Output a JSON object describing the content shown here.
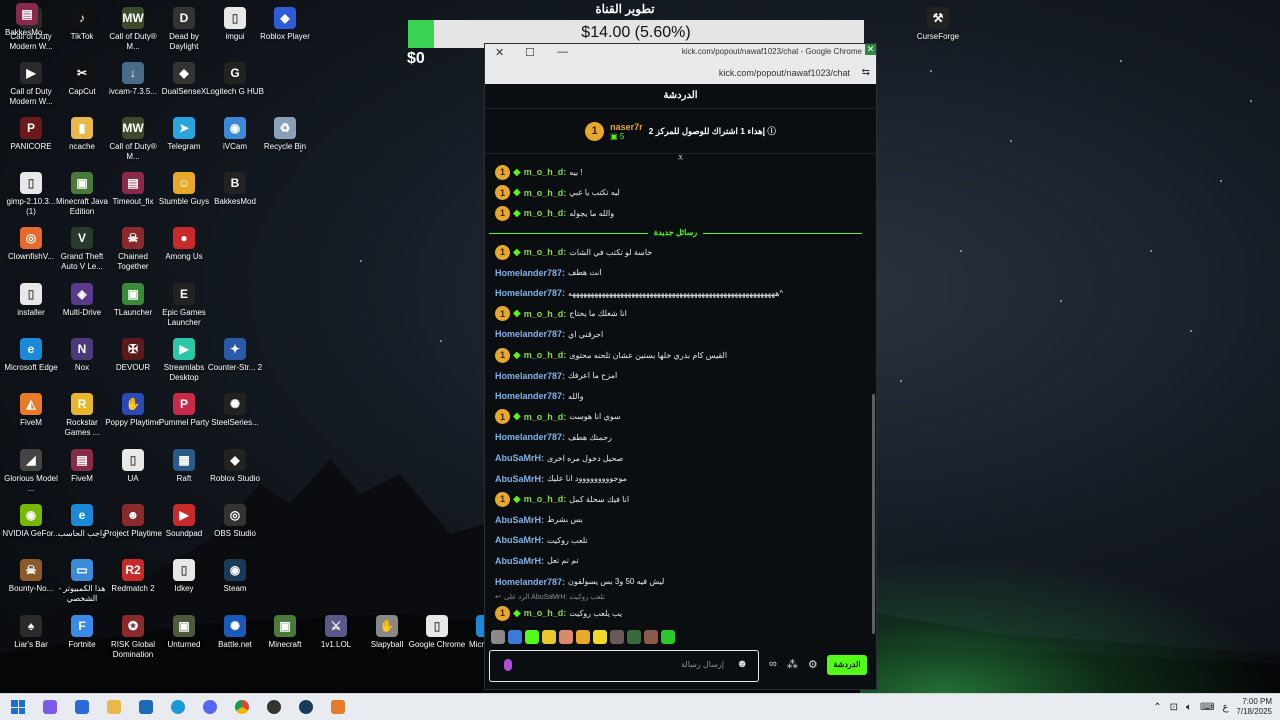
{
  "desktop_icons": [
    {
      "label": "Call of Duty Modern W...",
      "icon": "cod-mw-icon",
      "color": "#2a2a2a",
      "glyph": "▶"
    },
    {
      "label": "TikTok",
      "icon": "tiktok-icon",
      "color": "#111111",
      "glyph": "♪"
    },
    {
      "label": "Call of Duty® M...",
      "icon": "cod-mw2-icon",
      "color": "#3a4a2a",
      "glyph": "MW"
    },
    {
      "label": "Dead by Daylight",
      "icon": "dbd-icon",
      "color": "#333333",
      "glyph": "D"
    },
    {
      "label": "imgui",
      "icon": "file-icon",
      "color": "#e8e8e8",
      "glyph": "▯"
    },
    {
      "label": "Roblox Player",
      "icon": "roblox-icon",
      "color": "#2e5bd8",
      "glyph": "◆"
    },
    {
      "label": "Call of Duty Modern W...",
      "icon": "cod-mw-icon",
      "color": "#2a2a2a",
      "glyph": "▶"
    },
    {
      "label": "CapCut",
      "icon": "capcut-icon",
      "color": "#111111",
      "glyph": "✂"
    },
    {
      "label": "ivcam-7.3.5...",
      "icon": "ivcam-installer-icon",
      "color": "#4a6a8a",
      "glyph": "↓"
    },
    {
      "label": "DualSenseX",
      "icon": "dualsense-icon",
      "color": "#333333",
      "glyph": "◆"
    },
    {
      "label": "Logitech G HUB",
      "icon": "logitech-icon",
      "color": "#222222",
      "glyph": "G"
    },
    {
      "label": "PANICORE",
      "icon": "panicore-icon",
      "color": "#6a1a1a",
      "glyph": "P"
    },
    {
      "label": "ncache",
      "icon": "folder-icon",
      "color": "#e8b84a",
      "glyph": "▮"
    },
    {
      "label": "Call of Duty® M...",
      "icon": "cod-mw2-icon",
      "color": "#3a4a2a",
      "glyph": "MW"
    },
    {
      "label": "Telegram",
      "icon": "telegram-icon",
      "color": "#2aa3df",
      "glyph": "➤"
    },
    {
      "label": "iVCam",
      "icon": "ivcam-icon",
      "color": "#3a8ad8",
      "glyph": "◉"
    },
    {
      "label": "Recycle Bin",
      "icon": "recycle-bin-icon",
      "color": "#8aa0b8",
      "glyph": "♻"
    },
    {
      "label": "gimp-2.10.3... (1)",
      "icon": "file-icon",
      "color": "#e8e8e8",
      "glyph": "▯"
    },
    {
      "label": "Minecraft Java Edition",
      "icon": "minecraft-icon",
      "color": "#4a7a3a",
      "glyph": "▣"
    },
    {
      "label": "Timeout_fix",
      "icon": "winrar-icon",
      "color": "#8a2a4a",
      "glyph": "▤"
    },
    {
      "label": "Stumble Guys",
      "icon": "stumble-guys-icon",
      "color": "#e8a82a",
      "glyph": "☺"
    },
    {
      "label": "BakkesMod",
      "icon": "bakkesmod-icon",
      "color": "#222222",
      "glyph": "B"
    },
    {
      "label": "ClownfishV...",
      "icon": "clownfish-icon",
      "color": "#e86a2a",
      "glyph": "◎"
    },
    {
      "label": "Grand Theft Auto V Le...",
      "icon": "gta-icon",
      "color": "#2a3a2a",
      "glyph": "V"
    },
    {
      "label": "Chained Together",
      "icon": "chained-icon",
      "color": "#8a2a2a",
      "glyph": "☠"
    },
    {
      "label": "Among Us",
      "icon": "among-us-icon",
      "color": "#c82a2a",
      "glyph": "●"
    },
    {
      "label": "installer",
      "icon": "file-icon",
      "color": "#e8e8e8",
      "glyph": "▯"
    },
    {
      "label": "Multi-Drive",
      "icon": "multidrive-icon",
      "color": "#5a3a8a",
      "glyph": "◈"
    },
    {
      "label": "TLauncher",
      "icon": "tlauncher-icon",
      "color": "#3a8a3a",
      "glyph": "▣"
    },
    {
      "label": "Epic Games Launcher",
      "icon": "epic-icon",
      "color": "#222222",
      "glyph": "E"
    },
    {
      "label": "Microsoft Edge",
      "icon": "edge-icon",
      "color": "#1a8ad8",
      "glyph": "e"
    },
    {
      "label": "Nox",
      "icon": "nox-icon",
      "color": "#4a3a7a",
      "glyph": "N"
    },
    {
      "label": "DEVOUR",
      "icon": "devour-icon",
      "color": "#5a1a1a",
      "glyph": "✠"
    },
    {
      "label": "Streamlabs Desktop",
      "icon": "streamlabs-icon",
      "color": "#2ac8a8",
      "glyph": "▶"
    },
    {
      "label": "Counter-Str... 2",
      "icon": "cs2-icon",
      "color": "#2a5aa8",
      "glyph": "✦"
    },
    {
      "label": "FiveM",
      "icon": "fivem-icon",
      "color": "#e87a2a",
      "glyph": "◭"
    },
    {
      "label": "Rockstar Games ...",
      "icon": "rockstar-icon",
      "color": "#e8b82a",
      "glyph": "R"
    },
    {
      "label": "Poppy Playtime",
      "icon": "poppy-icon",
      "color": "#2a4ab8",
      "glyph": "✋"
    },
    {
      "label": "Pummel Party",
      "icon": "pummel-icon",
      "color": "#c82a4a",
      "glyph": "P"
    },
    {
      "label": "SteelSeries...",
      "icon": "steelseries-icon",
      "color": "#222222",
      "glyph": "✺"
    },
    {
      "label": "Glorious Model ...",
      "icon": "glorious-icon",
      "color": "#444444",
      "glyph": "◢"
    },
    {
      "label": "FiveM",
      "icon": "winrar-icon",
      "color": "#8a2a4a",
      "glyph": "▤"
    },
    {
      "label": "UA",
      "icon": "file-icon",
      "color": "#e8e8e8",
      "glyph": "▯"
    },
    {
      "label": "Raft",
      "icon": "raft-icon",
      "color": "#2a5a8a",
      "glyph": "▦"
    },
    {
      "label": "Roblox Studio",
      "icon": "roblox-studio-icon",
      "color": "#222222",
      "glyph": "◆"
    },
    {
      "label": "NVIDIA GeFor...",
      "icon": "nvidia-icon",
      "color": "#76b900",
      "glyph": "◉"
    },
    {
      "label": "واجب الحاسب",
      "icon": "edge-icon",
      "color": "#1a8ad8",
      "glyph": "e"
    },
    {
      "label": "Project Playtime",
      "icon": "project-playtime-icon",
      "color": "#8a2a2a",
      "glyph": "☻"
    },
    {
      "label": "Soundpad",
      "icon": "soundpad-icon",
      "color": "#c82a2a",
      "glyph": "▶"
    },
    {
      "label": "OBS Studio",
      "icon": "obs-icon",
      "color": "#333333",
      "glyph": "◎"
    },
    {
      "label": "Bounty-No...",
      "icon": "bounty-icon",
      "color": "#8a5a2a",
      "glyph": "☠"
    },
    {
      "label": "هذا الكمبيوتر - الشخصي",
      "icon": "this-pc-icon",
      "color": "#3a8ad8",
      "glyph": "▭"
    },
    {
      "label": "Redmatch 2",
      "icon": "redmatch-icon",
      "color": "#c82a2a",
      "glyph": "R2"
    },
    {
      "label": "Idkey",
      "icon": "file-icon",
      "color": "#e8e8e8",
      "glyph": "▯"
    },
    {
      "label": "Steam",
      "icon": "steam-icon",
      "color": "#1a3a5a",
      "glyph": "◉"
    },
    {
      "label": "Liar's Bar",
      "icon": "liars-bar-icon",
      "color": "#2a2a2a",
      "glyph": "♠"
    },
    {
      "label": "Fortnite",
      "icon": "fortnite-icon",
      "color": "#3a8ae8",
      "glyph": "F"
    },
    {
      "label": "RISK Global Domination",
      "icon": "risk-icon",
      "color": "#8a2a2a",
      "glyph": "✪"
    },
    {
      "label": "Unturned",
      "icon": "unturned-icon",
      "color": "#4a5a3a",
      "glyph": "▣"
    },
    {
      "label": "Battle.net",
      "icon": "battlenet-icon",
      "color": "#1a5ab8",
      "glyph": "✺"
    },
    {
      "label": "Minecraft",
      "icon": "minecraft-icon",
      "color": "#4a7a3a",
      "glyph": "▣"
    },
    {
      "label": "1v1.LOL",
      "icon": "1v1lol-icon",
      "color": "#5a5a8a",
      "glyph": "⚔"
    },
    {
      "label": "Slapyball",
      "icon": "slapyball-icon",
      "color": "#888888",
      "glyph": "✋"
    },
    {
      "label": "Google Chrome",
      "icon": "file-icon",
      "color": "#e8e8e8",
      "glyph": "▯"
    },
    {
      "label": "Micro Edg",
      "icon": "edge-icon",
      "color": "#1a8ad8",
      "glyph": "e"
    },
    {
      "label": "BakkesMo...",
      "icon": "winrar-icon",
      "color": "#8a2a4a",
      "glyph": "▤"
    },
    {
      "label": "CurseForge",
      "icon": "curseforge-icon",
      "color": "#222222",
      "glyph": "⚒"
    }
  ],
  "stream": {
    "title": "تطوير القناة",
    "goal_text": "$14.00 (5.60%)",
    "goal_fraction": 0.056,
    "zero_label": "$0"
  },
  "chrome": {
    "window_title": "kick.com/popout/nawaf1023/chat - Google Chrome",
    "url": "kick.com/popout/nawaf1023/chat",
    "ghost_text": "38.BAS 10.5.0"
  },
  "chat": {
    "header": "الدردشة",
    "pinned": {
      "user": "naser7r",
      "count": "5",
      "badge": "1",
      "text": "إهداء 1 اشتراك للوصول للمركز 2 ⓘ"
    },
    "new_messages_label": "رسائل جديدة",
    "messages_before": [
      {
        "user": "m_o_h_d",
        "badge": true,
        "text": "بيه !"
      },
      {
        "user": "m_o_h_d",
        "badge": true,
        "text": "ليه تكتب يا غبي"
      },
      {
        "user": "m_o_h_d",
        "badge": true,
        "text": "والله ما يجوله"
      }
    ],
    "messages_after": [
      {
        "user": "m_o_h_d",
        "badge": true,
        "text": "خاسة لو تكتب في الشات"
      },
      {
        "user": "Homelander787",
        "badge": false,
        "text": "انت هطف"
      },
      {
        "user": "Homelander787",
        "badge": false,
        "text": "ههههههههههههههههههههههههههههههههههههههههههههههههههههههههه^"
      },
      {
        "user": "m_o_h_d",
        "badge": true,
        "text": "انا شغلك ما يحتاج"
      },
      {
        "user": "Homelander787",
        "badge": false,
        "text": "احرقني اي"
      },
      {
        "user": "m_o_h_d",
        "badge": true,
        "text": "القيس كام بدري خلها بستين عشان تلحنه محتوى"
      },
      {
        "user": "Homelander787",
        "badge": false,
        "text": "امزح ما اعرفك"
      },
      {
        "user": "Homelander787",
        "badge": false,
        "text": "والله"
      },
      {
        "user": "m_o_h_d",
        "badge": true,
        "text": "سوي انا هوست"
      },
      {
        "user": "Homelander787",
        "badge": false,
        "text": "رحمتك هطف"
      },
      {
        "user": "AbuSaMrH",
        "badge": false,
        "text": "صحيل دخول مره اخرى"
      },
      {
        "user": "AbuSaMrH",
        "badge": false,
        "text": "موجووووووووود انا عليك"
      },
      {
        "user": "m_o_h_d",
        "badge": true,
        "text": "انا فيك سحلة كمل"
      },
      {
        "user": "AbuSaMrH",
        "badge": false,
        "text": "بس بشرط"
      },
      {
        "user": "AbuSaMrH",
        "badge": false,
        "text": "تلعب روكيت"
      },
      {
        "user": "AbuSaMrH",
        "badge": false,
        "text": "تم تم تعل"
      },
      {
        "user": "Homelander787",
        "badge": false,
        "text": "ليش فيه 50 و3 بس يسولفون"
      }
    ],
    "reply_preview": "الرد على AbuSaMrH: تلعب روكيت",
    "last_message": {
      "user": "m_o_h_d",
      "badge": true,
      "text": "يب يلعب روكيت"
    },
    "input_placeholder": "إرسال رسالة",
    "send_label": "الدردشة"
  },
  "colors": {
    "kick_green": "#53fc18",
    "gold": "#e6a72a",
    "user_green": "#8bd64b",
    "user_blue": "#7fb2e8"
  },
  "taskbar": {
    "apps": [
      "start-icon",
      "copilot-icon",
      "store-icon",
      "file-explorer-icon",
      "outlook-icon",
      "edge-icon",
      "discord-icon",
      "chrome-icon",
      "obs-icon",
      "steam-icon",
      "avast-icon"
    ],
    "lang": "ع",
    "time": "7:00 PM",
    "date": "7/18/2025"
  }
}
